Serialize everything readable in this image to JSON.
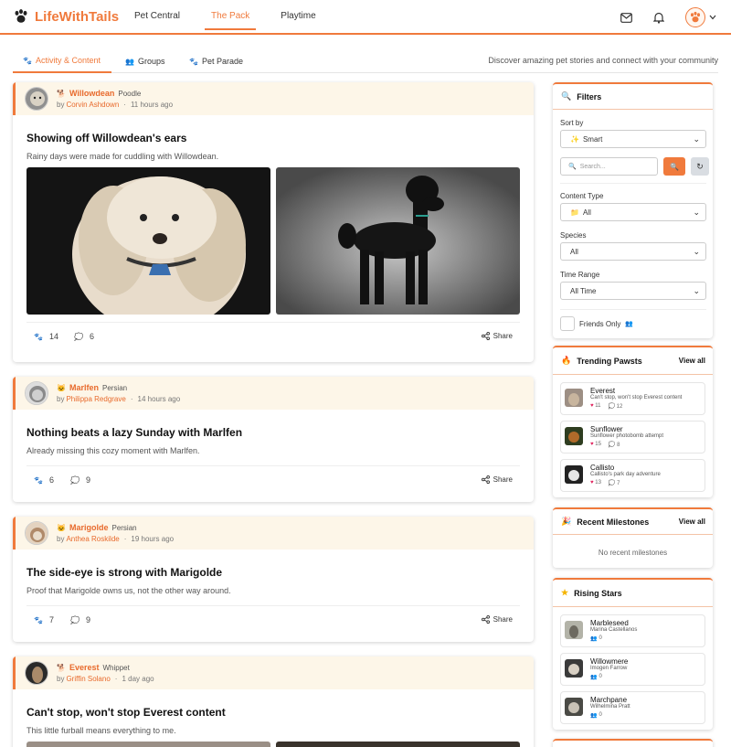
{
  "brand": {
    "name": "LifeWithTails",
    "accent": "#f07a3c"
  },
  "nav": {
    "items": [
      "Pet Central",
      "The Pack",
      "Playtime"
    ],
    "active": "The Pack"
  },
  "header_icons": [
    "mail-icon",
    "bell-icon",
    "paw-avatar-icon",
    "chevron-down-icon"
  ],
  "subnav": {
    "tabs": [
      "Activity & Content",
      "Groups",
      "Pet Parade"
    ],
    "active": "Activity & Content",
    "description": "Discover amazing pet stories and connect with your community"
  },
  "posts": [
    {
      "pet": "Willowdean",
      "breed": "Poodle",
      "by": "by",
      "owner": "Corvin Ashdown",
      "time": "11 hours ago",
      "title": "Showing off Willowdean's ears",
      "text": "Rainy days were made for cuddling with Willowdean.",
      "paws": "14",
      "comments": "6",
      "share": "Share"
    },
    {
      "pet": "Marlfen",
      "breed": "Persian",
      "by": "by",
      "owner": "Philippa Redgrave",
      "time": "14 hours ago",
      "title": "Nothing beats a lazy Sunday with Marlfen",
      "text": "Already missing this cozy moment with Marlfen.",
      "paws": "6",
      "comments": "9",
      "share": "Share"
    },
    {
      "pet": "Marigolde",
      "breed": "Persian",
      "by": "by",
      "owner": "Anthea Roskilde",
      "time": "19 hours ago",
      "title": "The side-eye is strong with Marigolde",
      "text": "Proof that Marigolde owns us, not the other way around.",
      "paws": "7",
      "comments": "9",
      "share": "Share"
    },
    {
      "pet": "Everest",
      "breed": "Whippet",
      "by": "by",
      "owner": "Griffin Solano",
      "time": "1 day ago",
      "title": "Can't stop, won't stop Everest content",
      "text": "This little furball means everything to me."
    }
  ],
  "filters": {
    "title": "Filters",
    "sort_label": "Sort by",
    "sort_value": "Smart",
    "search_placeholder": "Search...",
    "content_type_label": "Content Type",
    "content_type_value": "All",
    "species_label": "Species",
    "species_value": "All",
    "time_range_label": "Time Range",
    "time_range_value": "All Time",
    "friends_only": "Friends Only"
  },
  "trending": {
    "title": "Trending Pawsts",
    "view_all": "View all",
    "items": [
      {
        "name": "Everest",
        "desc": "Can't stop, won't stop Everest content",
        "likes": "11",
        "comments": "12"
      },
      {
        "name": "Sunflower",
        "desc": "Sunflower photobomb attempt",
        "likes": "15",
        "comments": "8"
      },
      {
        "name": "Callisto",
        "desc": "Callisto's park day adventure",
        "likes": "13",
        "comments": "7"
      }
    ]
  },
  "milestones": {
    "title": "Recent Milestones",
    "view_all": "View all",
    "empty": "No recent milestones"
  },
  "rising": {
    "title": "Rising Stars",
    "items": [
      {
        "name": "Marbleseed",
        "owner": "Marina Castellanos",
        "count": "0"
      },
      {
        "name": "Willowmere",
        "owner": "Imogen Farrow",
        "count": "0"
      },
      {
        "name": "Marchpane",
        "owner": "Wilhelmina Pratt",
        "count": "0"
      }
    ]
  }
}
